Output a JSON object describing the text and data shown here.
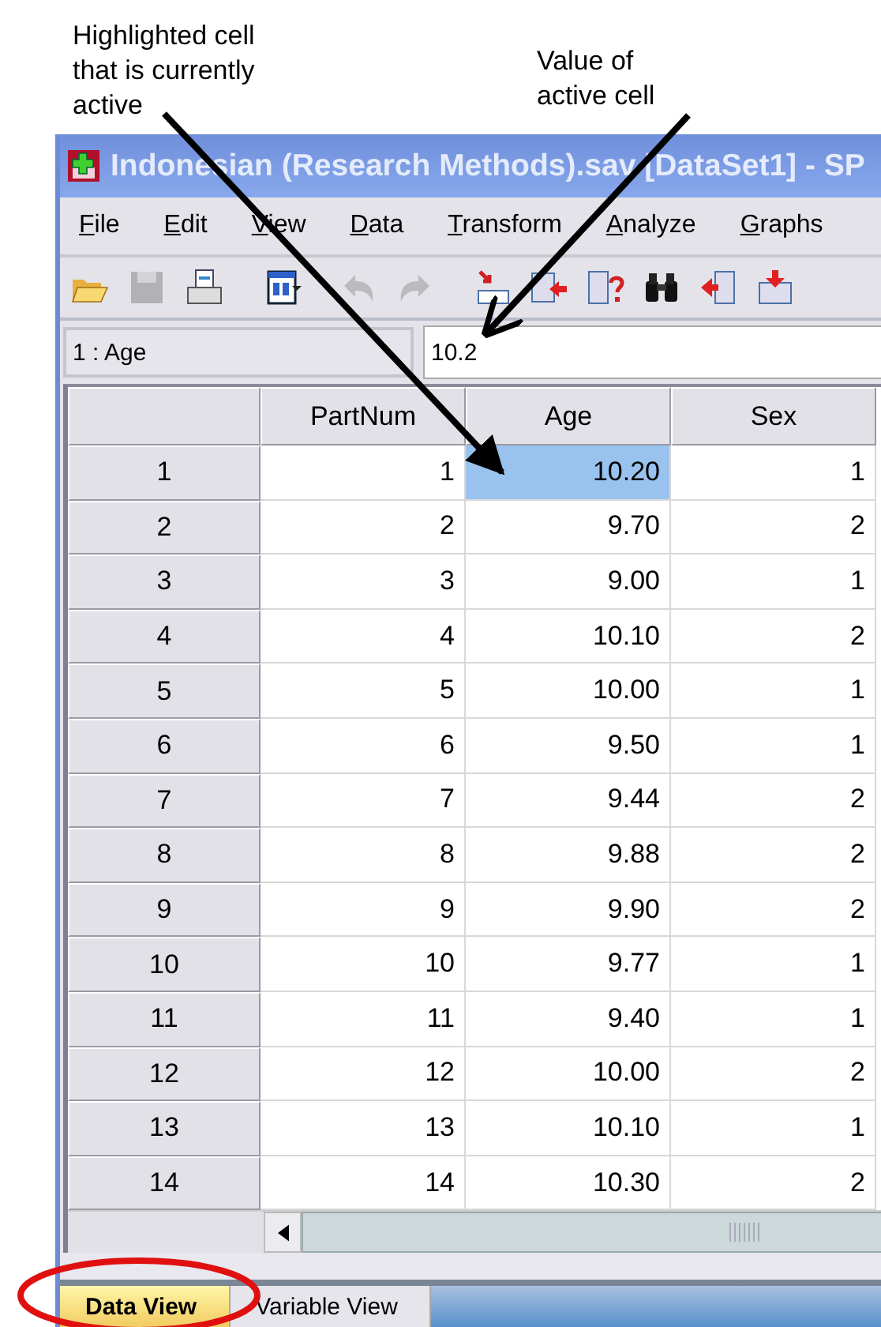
{
  "annotations": [
    {
      "text": "Highlighted cell\nthat is currently\nactive"
    },
    {
      "text": "Value of\nactive cell"
    }
  ],
  "window": {
    "title": "Indonesian (Research Methods).sav [DataSet1] - SP"
  },
  "menu": [
    "File",
    "Edit",
    "View",
    "Data",
    "Transform",
    "Analyze",
    "Graphs"
  ],
  "toolbar": [
    {
      "kind": "open",
      "disabled": false
    },
    {
      "kind": "save",
      "disabled": true
    },
    {
      "kind": "print",
      "disabled": false
    },
    {
      "kind": "dialog",
      "disabled": false
    },
    {
      "kind": "undo",
      "disabled": true
    },
    {
      "kind": "redo",
      "disabled": true
    },
    {
      "kind": "goto",
      "disabled": false
    },
    {
      "kind": "variable",
      "disabled": false
    },
    {
      "kind": "help",
      "disabled": false
    },
    {
      "kind": "find",
      "disabled": false
    },
    {
      "kind": "insertcol",
      "disabled": false
    },
    {
      "kind": "insertrow",
      "disabled": false
    }
  ],
  "cell_ref": "1 : Age",
  "cell_value": "10.2",
  "table": {
    "columns": [
      "PartNum",
      "Age",
      "Sex"
    ],
    "rows": [
      {
        "num": "1",
        "cells": [
          {
            "value": "1",
            "selected": false
          },
          {
            "value": "10.20",
            "selected": true
          },
          {
            "value": "1",
            "selected": false
          }
        ]
      },
      {
        "num": "2",
        "cells": [
          {
            "value": "2",
            "selected": false
          },
          {
            "value": "9.70",
            "selected": false
          },
          {
            "value": "2",
            "selected": false
          }
        ]
      },
      {
        "num": "3",
        "cells": [
          {
            "value": "3",
            "selected": false
          },
          {
            "value": "9.00",
            "selected": false
          },
          {
            "value": "1",
            "selected": false
          }
        ]
      },
      {
        "num": "4",
        "cells": [
          {
            "value": "4",
            "selected": false
          },
          {
            "value": "10.10",
            "selected": false
          },
          {
            "value": "2",
            "selected": false
          }
        ]
      },
      {
        "num": "5",
        "cells": [
          {
            "value": "5",
            "selected": false
          },
          {
            "value": "10.00",
            "selected": false
          },
          {
            "value": "1",
            "selected": false
          }
        ]
      },
      {
        "num": "6",
        "cells": [
          {
            "value": "6",
            "selected": false
          },
          {
            "value": "9.50",
            "selected": false
          },
          {
            "value": "1",
            "selected": false
          }
        ]
      },
      {
        "num": "7",
        "cells": [
          {
            "value": "7",
            "selected": false
          },
          {
            "value": "9.44",
            "selected": false
          },
          {
            "value": "2",
            "selected": false
          }
        ]
      },
      {
        "num": "8",
        "cells": [
          {
            "value": "8",
            "selected": false
          },
          {
            "value": "9.88",
            "selected": false
          },
          {
            "value": "2",
            "selected": false
          }
        ]
      },
      {
        "num": "9",
        "cells": [
          {
            "value": "9",
            "selected": false
          },
          {
            "value": "9.90",
            "selected": false
          },
          {
            "value": "2",
            "selected": false
          }
        ]
      },
      {
        "num": "10",
        "cells": [
          {
            "value": "10",
            "selected": false
          },
          {
            "value": "9.77",
            "selected": false
          },
          {
            "value": "1",
            "selected": false
          }
        ]
      },
      {
        "num": "11",
        "cells": [
          {
            "value": "11",
            "selected": false
          },
          {
            "value": "9.40",
            "selected": false
          },
          {
            "value": "1",
            "selected": false
          }
        ]
      },
      {
        "num": "12",
        "cells": [
          {
            "value": "12",
            "selected": false
          },
          {
            "value": "10.00",
            "selected": false
          },
          {
            "value": "2",
            "selected": false
          }
        ]
      },
      {
        "num": "13",
        "cells": [
          {
            "value": "13",
            "selected": false
          },
          {
            "value": "10.10",
            "selected": false
          },
          {
            "value": "1",
            "selected": false
          }
        ]
      },
      {
        "num": "14",
        "cells": [
          {
            "value": "14",
            "selected": false
          },
          {
            "value": "10.30",
            "selected": false
          },
          {
            "value": "2",
            "selected": false
          }
        ]
      }
    ]
  },
  "view_tabs": [
    {
      "label": "Data View",
      "selected": true
    },
    {
      "label": "Variable View",
      "selected": false
    }
  ]
}
